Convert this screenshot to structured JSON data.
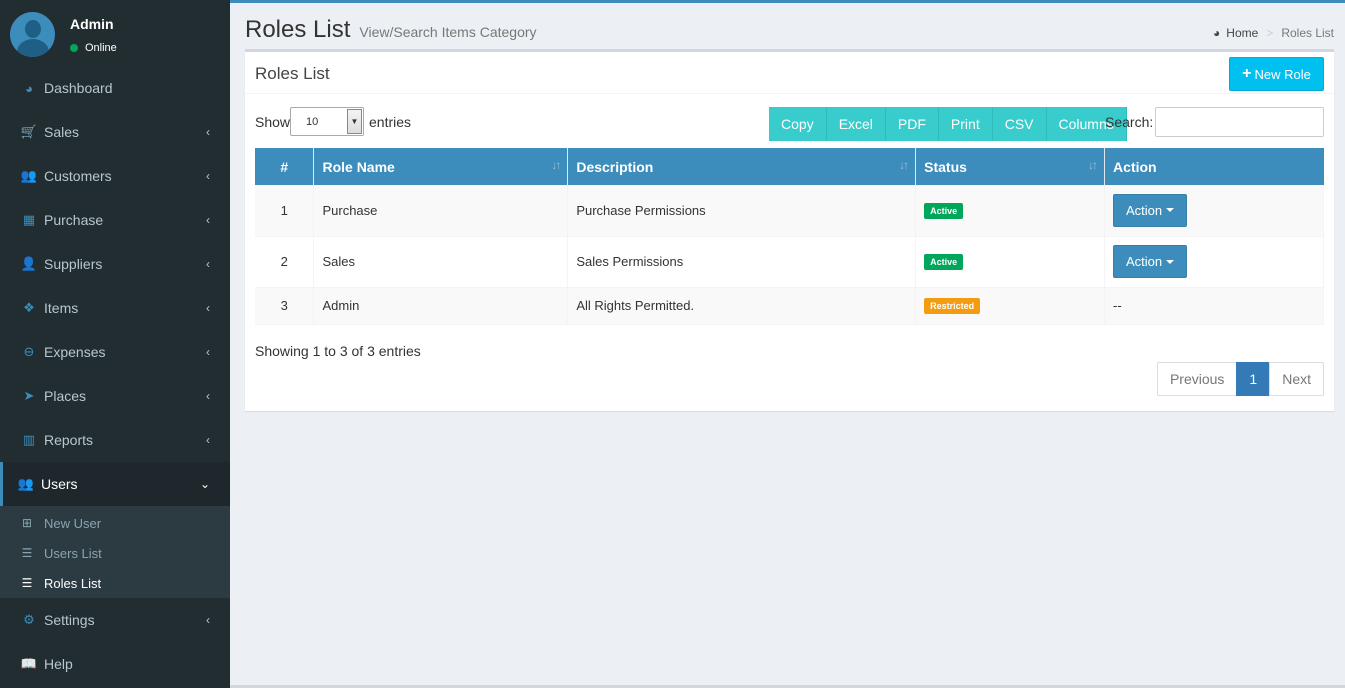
{
  "user": {
    "name": "Admin",
    "status": "Online"
  },
  "sidebar": {
    "items": [
      {
        "label": "Dashboard",
        "icon": "dashboard-icon",
        "glyph": "◕",
        "chevron": ""
      },
      {
        "label": "Sales",
        "icon": "cart-icon",
        "glyph": "🛒",
        "chevron": "‹"
      },
      {
        "label": "Customers",
        "icon": "users-icon",
        "glyph": "👥",
        "chevron": "‹"
      },
      {
        "label": "Purchase",
        "icon": "grid-icon",
        "glyph": "▦",
        "chevron": "‹"
      },
      {
        "label": "Suppliers",
        "icon": "user-plus-icon",
        "glyph": "👤",
        "chevron": "‹"
      },
      {
        "label": "Items",
        "icon": "cubes-icon",
        "glyph": "❖",
        "chevron": "‹"
      },
      {
        "label": "Expenses",
        "icon": "minus-circle-icon",
        "glyph": "⊖",
        "chevron": "‹"
      },
      {
        "label": "Places",
        "icon": "paper-plane-icon",
        "glyph": "➤",
        "chevron": "‹"
      },
      {
        "label": "Reports",
        "icon": "bar-chart-icon",
        "glyph": "▥",
        "chevron": "‹"
      },
      {
        "label": "Users",
        "icon": "users-icon",
        "glyph": "👥",
        "chevron": "⌄"
      }
    ],
    "submenu": [
      {
        "label": "New User",
        "glyph": "⊞"
      },
      {
        "label": "Users List",
        "glyph": "☰"
      },
      {
        "label": "Roles List",
        "glyph": "☰"
      }
    ],
    "bottom_items": [
      {
        "label": "Settings",
        "icon": "gears-icon",
        "glyph": "⚙",
        "chevron": "‹"
      },
      {
        "label": "Help",
        "icon": "book-icon",
        "glyph": "📖",
        "chevron": ""
      }
    ]
  },
  "header": {
    "title": "Roles List",
    "subtitle": "View/Search Items Category",
    "breadcrumb": {
      "home": "Home",
      "current": "Roles List"
    }
  },
  "box": {
    "title": "Roles List",
    "new_role_label": "New Role",
    "show_label": "Show",
    "show_value": "10",
    "entries_label": "entries",
    "export_buttons": [
      "Copy",
      "Excel",
      "PDF",
      "Print",
      "CSV",
      "Columns"
    ],
    "search_label": "Search:",
    "search_value": ""
  },
  "table": {
    "columns": [
      "#",
      "Role Name",
      "Description",
      "Status",
      "Action"
    ],
    "rows": [
      {
        "num": "1",
        "name": "Purchase",
        "description": "Purchase Permissions",
        "status": "Active",
        "action": "Action"
      },
      {
        "num": "2",
        "name": "Sales",
        "description": "Sales Permissions",
        "status": "Active",
        "action": "Action"
      },
      {
        "num": "3",
        "name": "Admin",
        "description": "All Rights Permitted.",
        "status": "Restricted",
        "action": "--"
      }
    ]
  },
  "info": "Showing 1 to 3 of 3 entries",
  "pagination": {
    "previous": "Previous",
    "page": "1",
    "next": "Next"
  },
  "colors": {
    "primary": "#3c8dbc",
    "sidebar": "#222d32",
    "info": "#00c0ef",
    "teal": "#39cccc",
    "success": "#00a65a",
    "warning": "#f39c12"
  }
}
